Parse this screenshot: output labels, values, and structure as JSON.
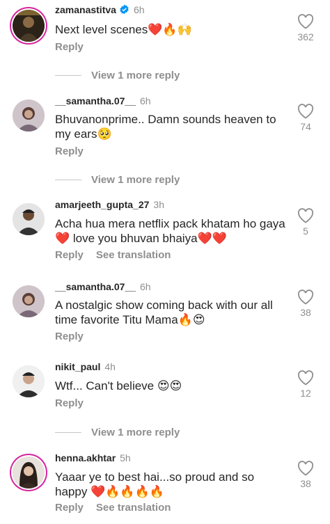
{
  "comments": [
    {
      "username": "zamanastitva",
      "time": "6h",
      "verified": true,
      "text": "Next level scenes❤️🔥🙌",
      "actions": [
        "Reply"
      ],
      "likes": "362"
    },
    {
      "username": "__samantha.07__",
      "time": "6h",
      "verified": false,
      "text": "Bhuvanonprime.. Damn sounds heaven to my ears🥺",
      "actions": [
        "Reply"
      ],
      "likes": "74"
    },
    {
      "username": "amarjeeth_gupta_27",
      "time": "3h",
      "verified": false,
      "text": "Acha hua mera netflix pack khatam ho gaya ❤️ love you bhuvan bhaiya❤️❤️",
      "actions": [
        "Reply",
        "See translation"
      ],
      "likes": "5"
    },
    {
      "username": "__samantha.07__",
      "time": "6h",
      "verified": false,
      "text": "A nostalgic show coming back with our all time favorite Titu Mama🔥😍",
      "actions": [
        "Reply"
      ],
      "likes": "38"
    },
    {
      "username": "nikit_paul",
      "time": "4h",
      "verified": false,
      "text": "Wtf... Can't believe 😍😍",
      "actions": [
        "Reply"
      ],
      "likes": "12"
    },
    {
      "username": "henna.akhtar",
      "time": "5h",
      "verified": false,
      "text": "Yaaar ye to best hai...so proud and so happy ❤️🔥🔥🔥🔥",
      "actions": [
        "Reply",
        "See translation"
      ],
      "likes": "38"
    }
  ],
  "view_more": [
    "View 1 more reply",
    "View 1 more reply",
    "View 1 more reply"
  ],
  "colors": {
    "text": "#262626",
    "muted": "#8e8e8e",
    "verified": "#0095f6",
    "story_ring": "#d6249f"
  }
}
